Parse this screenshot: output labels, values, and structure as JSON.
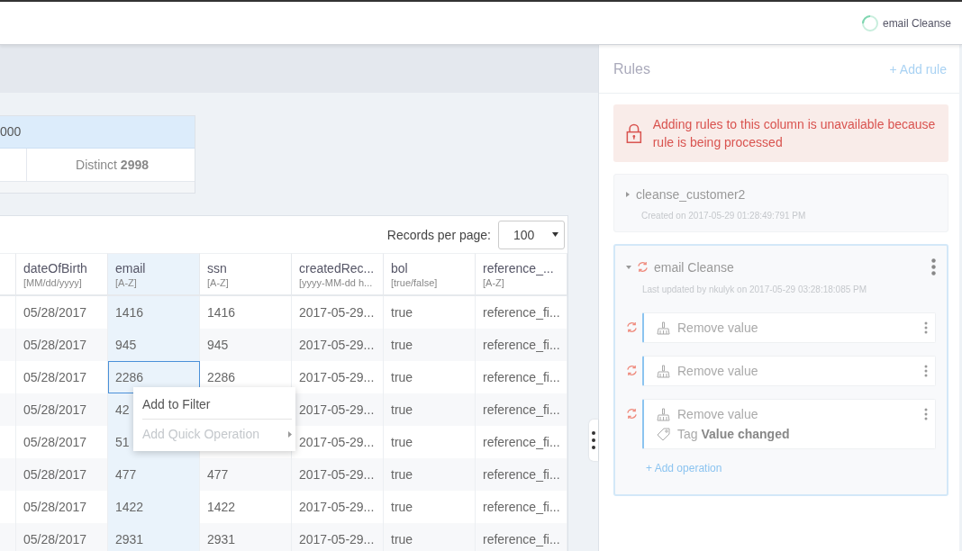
{
  "topbar": {
    "job": {
      "label": "email Cleanse",
      "running": true
    }
  },
  "stats": {
    "header": "000",
    "distinct": "Distinct **2998**"
  },
  "table": {
    "records_per_page": {
      "label": "Records per page:",
      "value": "100"
    },
    "columns": [
      {
        "name": "dateOfBirth",
        "hint": "[MM/dd/yyyy]",
        "selected": false
      },
      {
        "name": "email",
        "hint": "[A-Z]",
        "selected": true
      },
      {
        "name": "ssn",
        "hint": "[A-Z]",
        "selected": false
      },
      {
        "name": "createdRec...",
        "hint": "[yyyy-MM-dd h...",
        "selected": false
      },
      {
        "name": "bol",
        "hint": "[true/false]",
        "selected": false
      },
      {
        "name": "reference_...",
        "hint": "[A-Z]",
        "selected": false
      }
    ],
    "rows": [
      {
        "cells": [
          "05/28/2017",
          "1416",
          "1416",
          "2017-05-29...",
          "true",
          "reference_fi..."
        ],
        "selected": false
      },
      {
        "cells": [
          "05/28/2017",
          "945",
          "945",
          "2017-05-29...",
          "true",
          "reference_fi..."
        ],
        "selected": false
      },
      {
        "cells": [
          "05/28/2017",
          "2286",
          "2286",
          "2017-05-29...",
          "true",
          "reference_fi..."
        ],
        "selected": true
      },
      {
        "cells": [
          "05/28/2017",
          "42",
          "",
          "2017-05-29...",
          "true",
          "reference_fi..."
        ],
        "selected": false
      },
      {
        "cells": [
          "05/28/2017",
          "51",
          "",
          "2017-05-29...",
          "true",
          "reference_fi..."
        ],
        "selected": false
      },
      {
        "cells": [
          "05/28/2017",
          "477",
          "477",
          "2017-05-29...",
          "true",
          "reference_fi..."
        ],
        "selected": false
      },
      {
        "cells": [
          "05/28/2017",
          "1422",
          "1422",
          "2017-05-29...",
          "true",
          "reference_fi..."
        ],
        "selected": false
      },
      {
        "cells": [
          "05/28/2017",
          "2931",
          "2931",
          "2017-05-29...",
          "true",
          "reference_fi..."
        ],
        "selected": false
      }
    ]
  },
  "context_menu": {
    "items": [
      {
        "label": "Add to Filter",
        "disabled": false,
        "submenu": false
      },
      {
        "label": "Add Quick Operation",
        "disabled": true,
        "submenu": true
      }
    ]
  },
  "rules_panel": {
    "title": "Rules",
    "add_button": "+ Add rule",
    "alert": "Adding rules to this column is unavailable because rule is being processed",
    "rules": [
      {
        "name": "cleanse_customer2",
        "meta": "Created on 2017-05-29 01:28:49:791 PM",
        "expanded": false,
        "processing": false
      },
      {
        "name": "email Cleanse",
        "meta": "Last updated by nkulyk on 2017-05-29 03:28:18:085 PM",
        "expanded": true,
        "processing": true,
        "add_operation": "+ Add operation",
        "operations": [
          {
            "label": "Remove value",
            "processing": true
          },
          {
            "label": "Remove value",
            "processing": true
          },
          {
            "label": "Remove value",
            "processing": true,
            "tag": "Tag **Value changed**"
          }
        ]
      }
    ]
  }
}
